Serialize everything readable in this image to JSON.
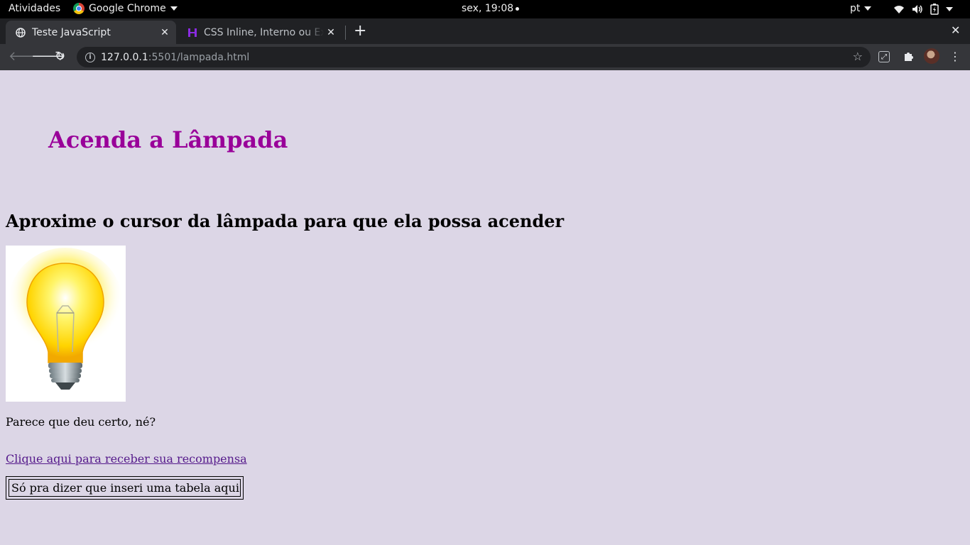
{
  "system_bar": {
    "activities": "Atividades",
    "app_name": "Google Chrome",
    "clock": "sex, 19:08",
    "language": "pt"
  },
  "browser": {
    "tabs": [
      {
        "title": "Teste JavaScript",
        "active": true,
        "favicon": "globe-icon"
      },
      {
        "title": "CSS Inline, Interno ou Externo",
        "active": false,
        "favicon": "h-logo-icon"
      }
    ],
    "url_host": "127.0.0.1",
    "url_rest": ":5501/lampada.html"
  },
  "page": {
    "heading": "Acenda a Lâmpada",
    "subheading": "Aproxime o cursor da lâmpada para que ela possa acender",
    "image": "lightbulb-on",
    "paragraph": "Parece que deu certo, né?",
    "link_text": "Clique aqui para receber sua recompensa",
    "table_cell": "Só pra dizer que inseri uma tabela aqui"
  },
  "colors": {
    "page_background": "#dcd6e6",
    "heading": "#990099",
    "link": "#551a8b"
  }
}
